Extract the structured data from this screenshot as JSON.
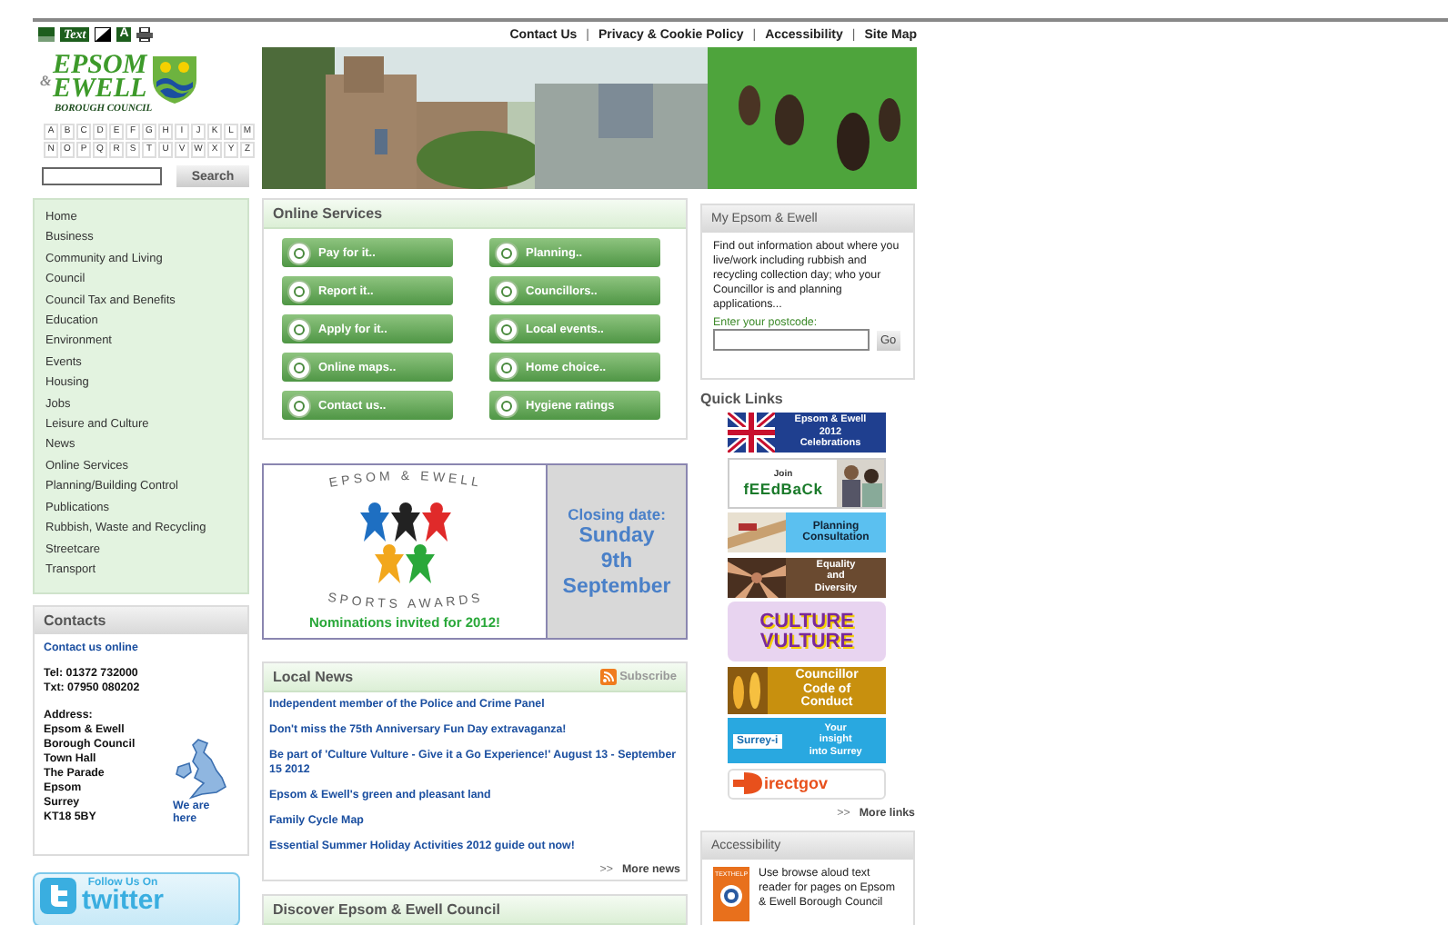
{
  "toolbar": {
    "text_button": "Text",
    "font_button": "A"
  },
  "top_links": [
    "Contact Us",
    "Privacy & Cookie Policy",
    "Accessibility",
    "Site Map"
  ],
  "top_link_separator": "|",
  "logo": {
    "line_1": "EPSOM",
    "ampersand": "&",
    "line_2": "EWELL",
    "subtitle": "BOROUGH COUNCIL"
  },
  "alphabet": [
    "A",
    "B",
    "C",
    "D",
    "E",
    "F",
    "G",
    "H",
    "I",
    "J",
    "K",
    "L",
    "M",
    "N",
    "O",
    "P",
    "Q",
    "R",
    "S",
    "T",
    "U",
    "V",
    "W",
    "X",
    "Y",
    "Z"
  ],
  "search": {
    "button": "Search"
  },
  "nav": [
    "Home",
    "Business",
    "Community and Living",
    "Council",
    "Council Tax and Benefits",
    "Education",
    "Environment",
    "Events",
    "Housing",
    "Jobs",
    "Leisure and Culture",
    "News",
    "Online Services",
    "Planning/Building Control",
    "Publications",
    "Rubbish, Waste and Recycling",
    "Streetcare",
    "Transport"
  ],
  "contacts": {
    "title": "Contacts",
    "link": "Contact us online",
    "phones": [
      "Tel: 01372 732000",
      "Txt: 07950 080202"
    ],
    "address_label": "Address:",
    "address": [
      "Epsom & Ewell Borough Council",
      "Town Hall",
      "The Parade",
      "Epsom",
      "Surrey",
      "KT18 5BY"
    ],
    "map_link": "We are here"
  },
  "twitter": {
    "caption": "Follow Us On",
    "name": "twitter"
  },
  "online_services": {
    "title": "Online Services",
    "buttons": [
      "Pay for it..",
      "Planning..",
      "Report it..",
      "Councillors..",
      "Apply for it..",
      "Local events..",
      "Online maps..",
      "Home choice..",
      "Contact us..",
      "Hygiene ratings"
    ]
  },
  "awards": {
    "ring_top": "EPSOM & EWELL",
    "ring_bottom": "SPORTS AWARDS",
    "closing": "Closing date:",
    "day": "Sunday",
    "date": "9th",
    "month": "September",
    "footer": "Nominations invited for 2012!"
  },
  "local_news": {
    "title": "Local News",
    "subscribe": "Subscribe",
    "items": [
      "Independent member of the Police and Crime Panel",
      "Don't miss the 75th Anniversary Fun Day extravaganza!",
      "Be part of 'Culture Vulture - Give it a Go Experience!' August 13 - September 15 2012",
      "Epsom & Ewell's green and pleasant land",
      "Family Cycle Map",
      "Essential Summer Holiday Activities 2012 guide out now!"
    ],
    "more_arrows": ">>",
    "more": "More news"
  },
  "discover": {
    "title": "Discover Epsom & Ewell Council"
  },
  "my_area": {
    "title": "My Epsom & Ewell",
    "text": "Find out information about where you live/work including rubbish and recycling collection day; who your Councillor is and planning applications...",
    "label": "Enter your postcode:",
    "button": "Go"
  },
  "quick_links": {
    "title": "Quick Links",
    "banners": [
      {
        "kind": "flag",
        "lines": [
          "Epsom & Ewell",
          "2012",
          "Celebrations"
        ]
      },
      {
        "kind": "feedback",
        "lines": [
          "Join",
          "fEEdBaCk"
        ]
      },
      {
        "kind": "planning",
        "lines": [
          "Planning",
          "Consultation"
        ]
      },
      {
        "kind": "equality",
        "lines": [
          "Equality",
          "and",
          "Diversity"
        ]
      },
      {
        "kind": "vulture",
        "lines": [
          "CULTURE",
          "VULTURE"
        ]
      },
      {
        "kind": "code",
        "lines": [
          "Councillor",
          "Code of",
          "Conduct"
        ]
      },
      {
        "kind": "surrey",
        "lines": [
          "Surrey-i",
          "Your",
          "insight",
          "into Surrey"
        ]
      },
      {
        "kind": "directgov",
        "lines": [
          "irectgov"
        ]
      }
    ],
    "more_arrows": ">>",
    "more": "More links"
  },
  "accessibility": {
    "title": "Accessibility",
    "badge": "TEXTHELP",
    "text": "Use browse aloud text reader for pages on Epsom & Ewell Borough Council"
  }
}
